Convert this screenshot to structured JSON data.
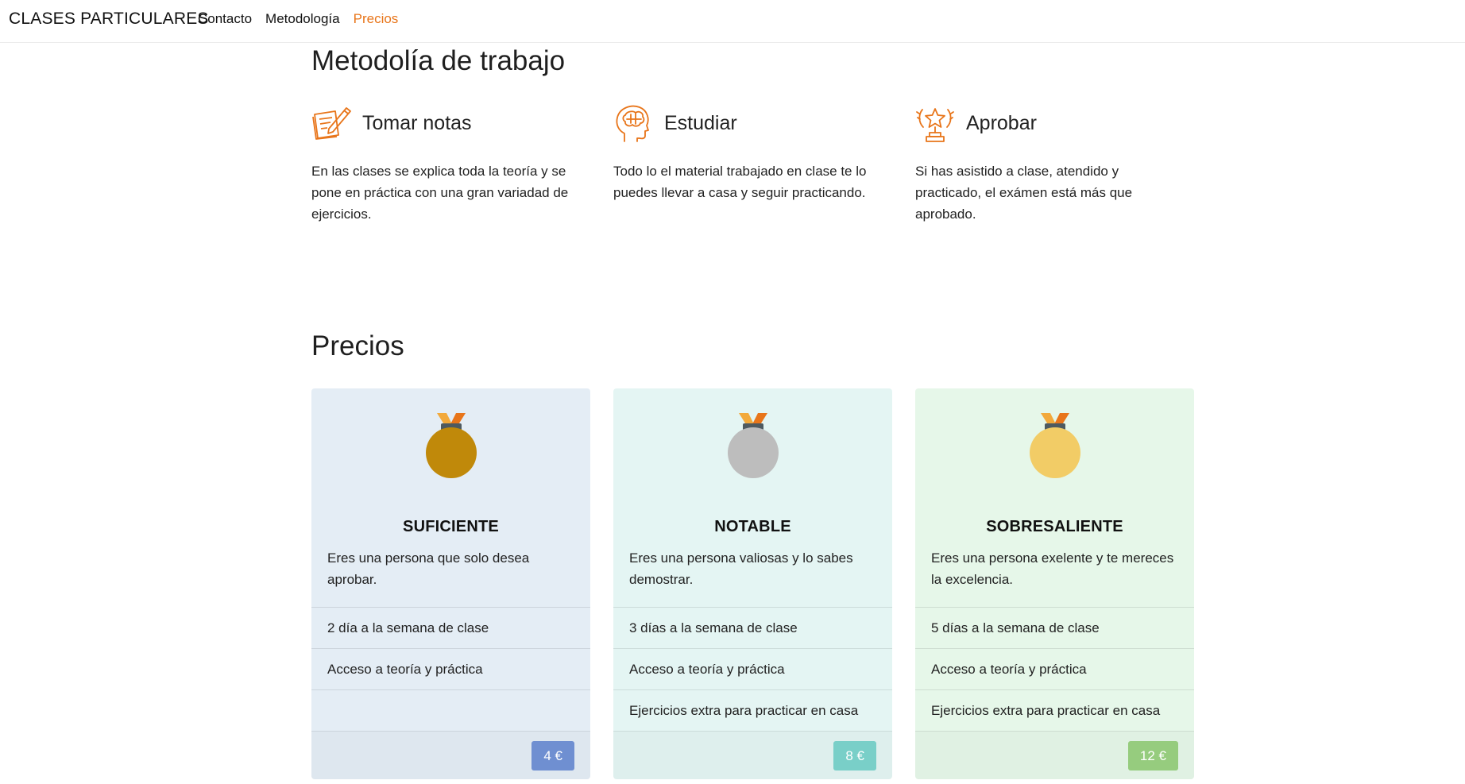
{
  "navbar": {
    "brand": "CLASES PARTICULARES",
    "links": [
      {
        "label": "Contacto",
        "active": false
      },
      {
        "label": "Metodología",
        "active": false
      },
      {
        "label": "Precios",
        "active": true
      }
    ]
  },
  "methodology": {
    "title": "Metodolía de trabajo",
    "items": [
      {
        "icon": "notes-icon",
        "title": "Tomar notas",
        "text": "En las clases se explica toda la teoría y se pone en práctica con una gran variadad de ejercicios."
      },
      {
        "icon": "brain-icon",
        "title": "Estudiar",
        "text": "Todo lo el material trabajado en clase te lo puedes llevar a casa y seguir practicando."
      },
      {
        "icon": "trophy-star-icon",
        "title": "Aprobar",
        "text": "Si has asistido a clase, atendido y practicado, el exámen está más que aprobado."
      }
    ]
  },
  "pricing": {
    "title": "Precios",
    "cards": [
      {
        "title": "SUFICIENTE",
        "desc": "Eres una persona que solo desea aprobar.",
        "items": [
          "2 día a la semana de clase",
          "Acceso a teoría y práctica",
          ""
        ],
        "price": "4 €",
        "medal_color": "#c0890a",
        "bg": "#e4edf5",
        "btn_color": "#6f8fd1"
      },
      {
        "title": "NOTABLE",
        "desc": "Eres una persona valiosas y lo sabes demostrar.",
        "items": [
          "3 días a la semana de clase",
          "Acceso a teoría y práctica",
          "Ejercicios extra para practicar en casa"
        ],
        "price": "8 €",
        "medal_color": "#bdbdbd",
        "bg": "#e4f5f3",
        "btn_color": "#79cfc8"
      },
      {
        "title": "SOBRESALIENTE",
        "desc": "Eres una persona exelente y te mereces la excelencia.",
        "items": [
          "5 días a la semana de clase",
          "Acceso a teoría y práctica",
          "Ejercicios extra para practicar en casa"
        ],
        "price": "12 €",
        "medal_color": "#f2cc66",
        "bg": "#e6f7e9",
        "btn_color": "#96cc7e"
      }
    ]
  },
  "colors": {
    "accent": "#e8751a"
  }
}
